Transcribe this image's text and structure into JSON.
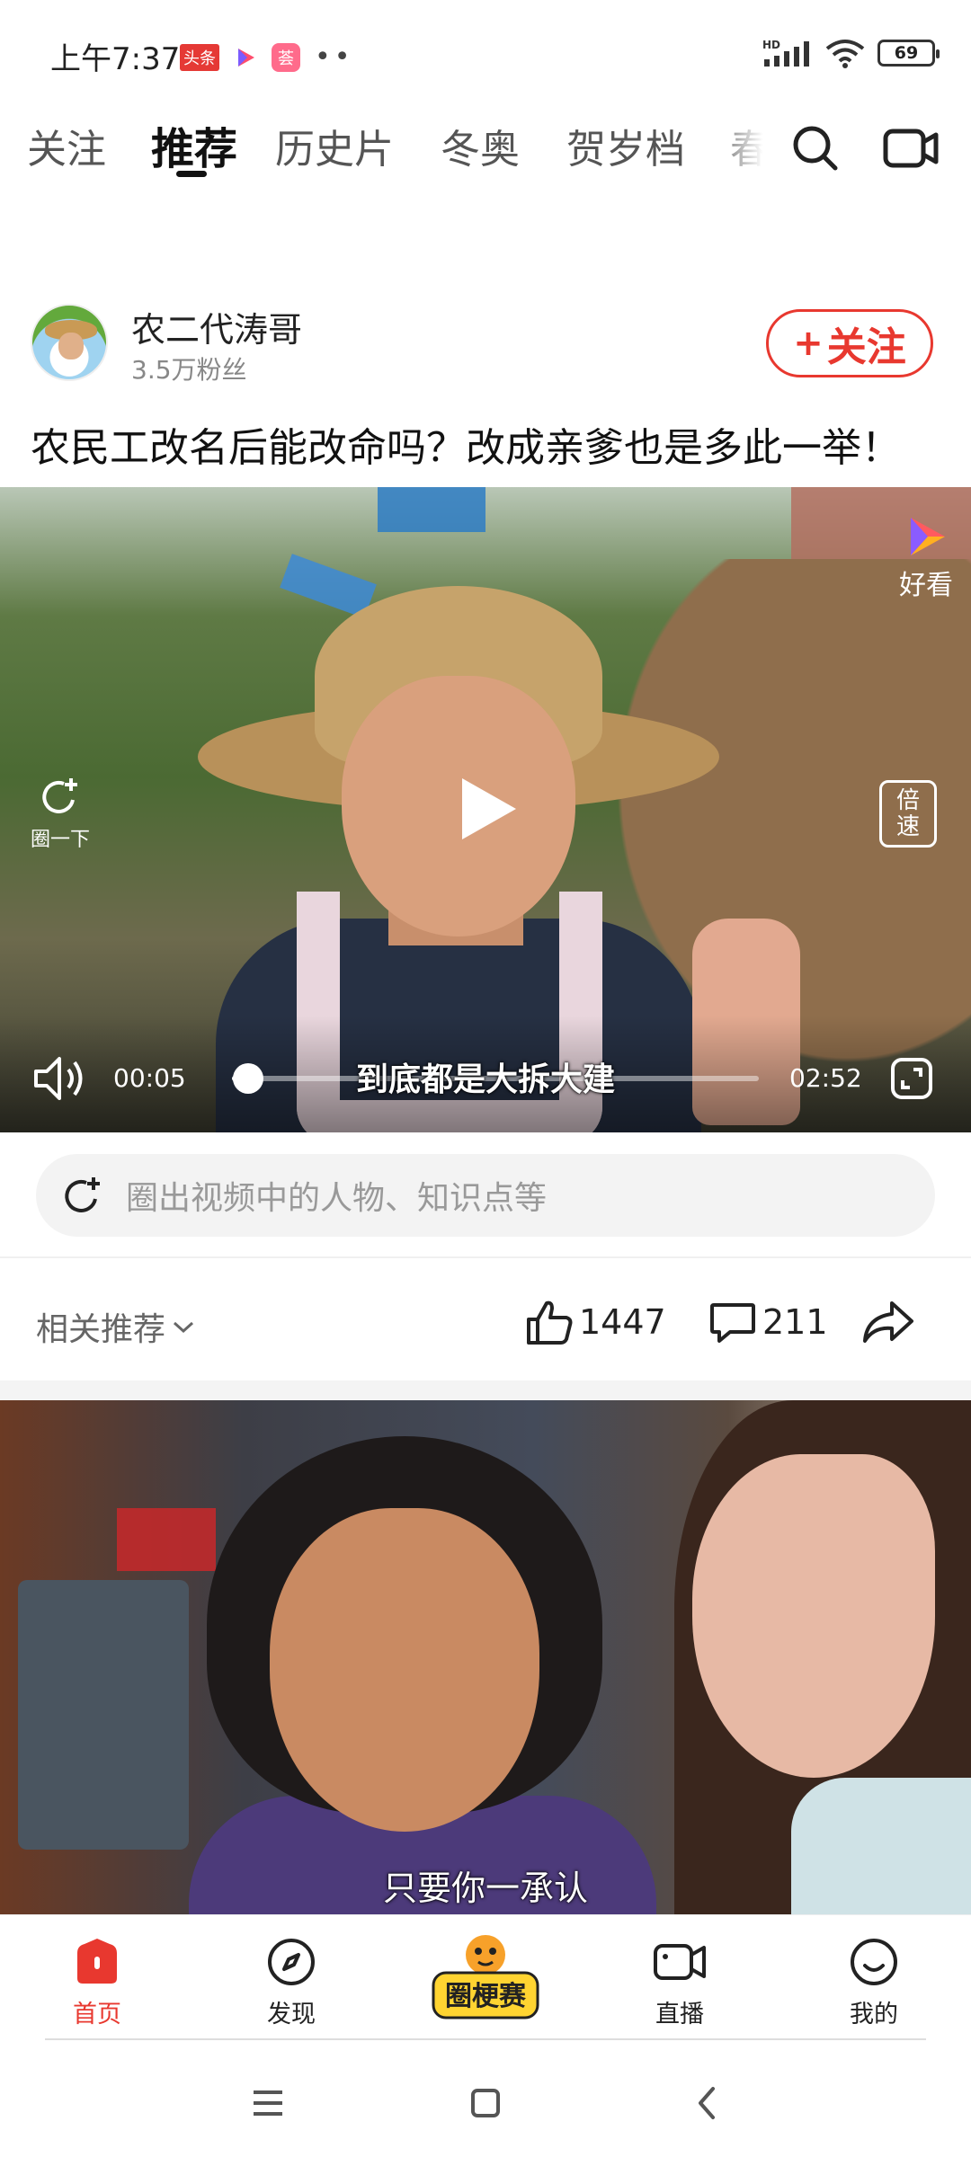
{
  "status_bar": {
    "time": "上午7:37",
    "toutiao_badge": "头条",
    "app_badge": "荟",
    "overflow": "••",
    "network": "HD",
    "battery": "69"
  },
  "tabs": {
    "items": [
      "关注",
      "推荐",
      "历史片",
      "冬奥",
      "贺岁档",
      "春"
    ],
    "active_index": 1
  },
  "post": {
    "author_name": "农二代涛哥",
    "author_fans": "3.5万粉丝",
    "follow_label": "关注",
    "follow_plus": "+",
    "title": "农民工改名后能改命吗？改成亲爹也是多此一举！"
  },
  "video": {
    "brand_label": "好看",
    "circle_label": "圈一下",
    "speed_label": "倍速",
    "current_time": "00:05",
    "duration": "02:52",
    "progress_fraction": 0.03,
    "subtitle": "到底都是大拆大建"
  },
  "circle_search": {
    "placeholder": "圈出视频中的人物、知识点等"
  },
  "actions": {
    "related_label": "相关推荐",
    "likes": "1447",
    "comments": "211"
  },
  "video2": {
    "subtitle": "只要你一承认"
  },
  "bottom_nav": {
    "home": "首页",
    "discover": "发现",
    "center_badge": "圈梗赛",
    "live": "直播",
    "mine": "我的"
  },
  "colors": {
    "accent": "#e8382f",
    "text": "#222222",
    "muted": "#888888"
  }
}
